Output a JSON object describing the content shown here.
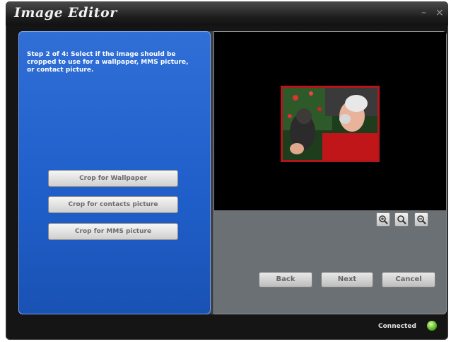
{
  "window": {
    "title": "Image Editor",
    "minimize_glyph": "–",
    "close_glyph": "×"
  },
  "left_panel": {
    "instructions": "Step 2 of 4: Select if the image should be cropped to use for a wallpaper, MMS picture, or contact picture.",
    "buttons": {
      "wallpaper": "Crop for Wallpaper",
      "contacts": "Crop for contacts picture",
      "mms": "Crop for MMS picture"
    }
  },
  "preview": {
    "frame_color": "#b2161c",
    "zoom_icons": [
      "zoom-in-icon",
      "zoom-fit-icon",
      "zoom-out-icon"
    ]
  },
  "navigation": {
    "back": "Back",
    "next": "Next",
    "cancel": "Cancel"
  },
  "status": {
    "text": "Connected",
    "icon": "connected-status-icon",
    "color": "#6fcf2a"
  },
  "colors": {
    "panel_blue": "#2766d0",
    "window_dark": "#151515",
    "preview_gray": "#6b7075"
  }
}
